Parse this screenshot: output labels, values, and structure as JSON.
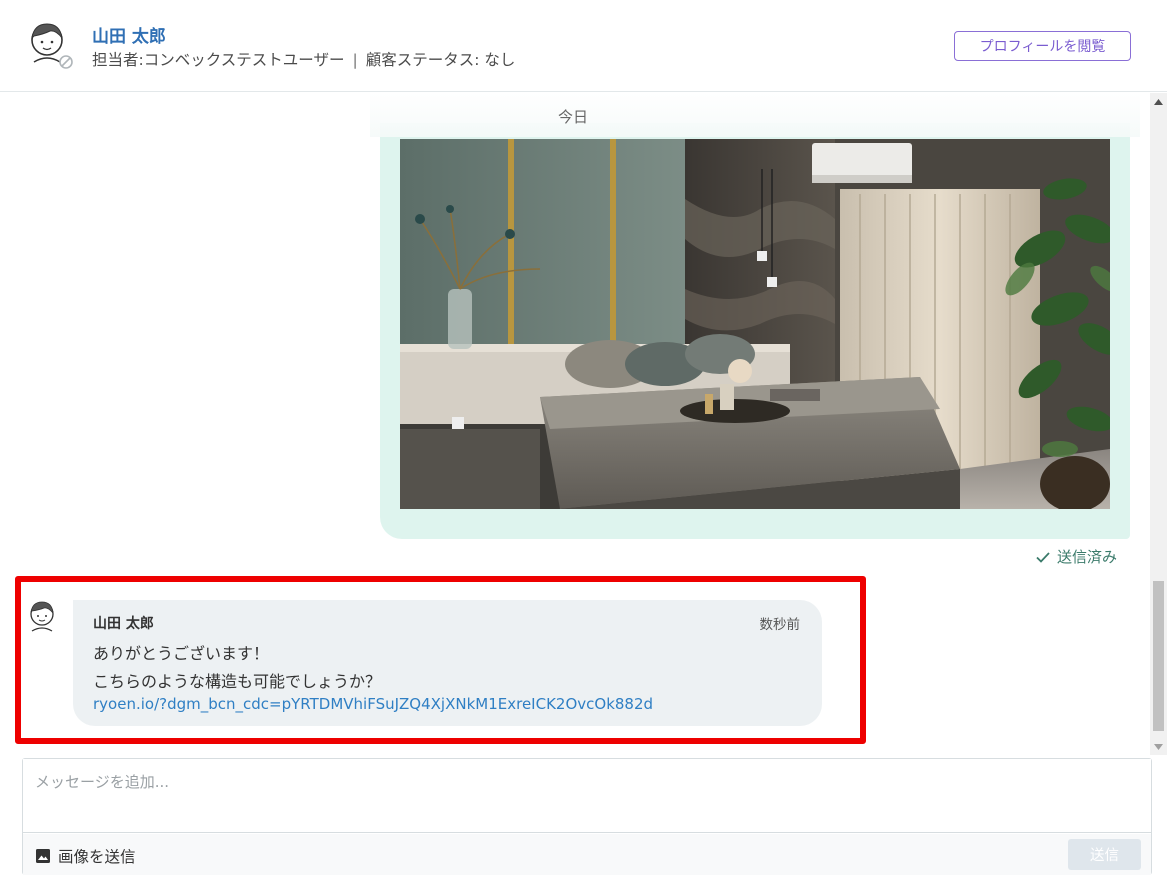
{
  "header": {
    "customer_name": "山田 太郎",
    "assignee_label": "担当者:コンベックステストユーザー",
    "separator": "|",
    "status_label": "顧客ステータス: なし",
    "profile_button": "プロフィールを閲覧"
  },
  "chat": {
    "date_divider": "今日",
    "sent_status": "送信済み",
    "message": {
      "sender": "山田 太郎",
      "time": "数秒前",
      "line1": "ありがとうございます！",
      "line2": "こちらのような構造も可能でしょうか？",
      "link": "ryoen.io/?dgm_bcn_cdc=pYRTDMVhiFSuJZQ4XjXNkM1ExreICK2OvcOk882d"
    }
  },
  "composer": {
    "placeholder": "メッセージを追加...",
    "image_send_label": "画像を送信",
    "send_button": "送信"
  },
  "colors": {
    "name_blue": "#2f6fb4",
    "profile_purple": "#7a5cd0",
    "sent_bubble": "#def4ee",
    "incoming_bubble": "#edf1f3",
    "highlight_red": "#ee0000",
    "link_blue": "#2f7fc4"
  }
}
